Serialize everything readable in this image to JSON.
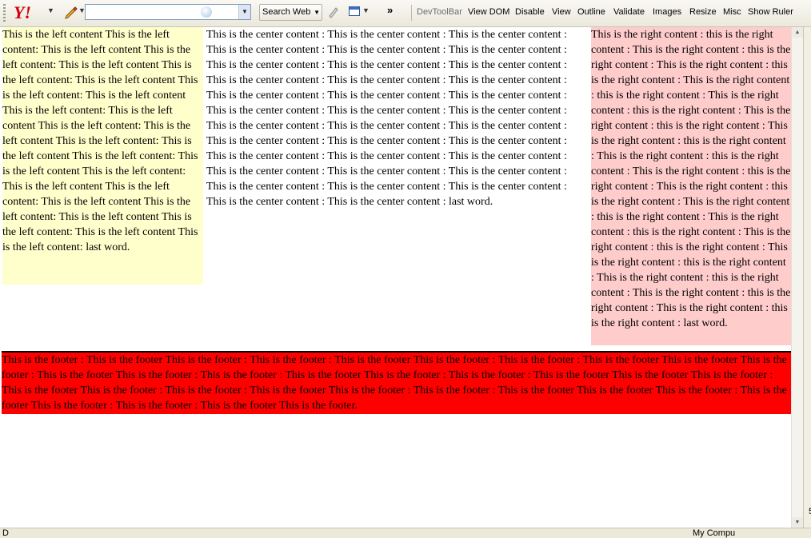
{
  "toolbar": {
    "logo": "Y!",
    "search_value": "",
    "search_button": "Search Web",
    "overflow": "»",
    "devtoolbar_label": "DevToolBar",
    "items": [
      "View DOM",
      "Disable",
      "View",
      "Outline",
      "Validate",
      "Images",
      "Resize",
      "Misc",
      "Show Ruler"
    ]
  },
  "content": {
    "left": "This is the left content This is the left content: This is the left content This is the left content: This is the left content This is the left content: This is the left content This is the left content: This is the left content This is the left content: This is the left content This is the left content: This is the left content This is the left content: This is the left content This is the left content: This is the left content This is the left content: This is the left content This is the left content: This is the left content This is the left content: This is the left content This is the left content: This is the left content This is the left content: last word.",
    "center": "This is the center content : This is the center content : This is the center content : This is the center content : This is the center content : This is the center content : This is the center content : This is the center content : This is the center content : This is the center content : This is the center content : This is the center content : This is the center content : This is the center content : This is the center content : This is the center content : This is the center content : This is the center content : This is the center content : This is the center content : This is the center content : This is the center content : This is the center content : This is the center content : This is the center content : This is the center content : This is the center content : This is the center content : This is the center content : This is the center content : This is the center content : This is the center content : This is the center content : This is the center content : This is the center content : last word.",
    "right": "This is the right content : this is the right content : This is the right content : this is the right content : This is the right content : this is the right content : This is the right content : this is the right content : This is the right content : this is the right content : This is the right content : this is the right content : This is the right content : this is the right content : This is the right content : this is the right content : This is the right content : this is the right content : This is the right content : this is the right content : This is the right content : this is the right content : This is the right content : this is the right content : This is the right content : this is the right content : This is the right content : this is the right content : This is the right content : this is the right content : This is the right content : this is the right content : This is the right content : this is the right content : last word.",
    "footer": "This is the footer : This is the footer This is the footer : This is the footer : This is the footer This is the footer : This is the footer : This is the footer This is the footer This is the footer : This is the footer This is the footer : This is the footer : This is the footer This is the footer : This is the footer : This is the footer This is the footer This is the footer : This is the footer This is the footer : This is the footer : This is the footer This is the footer : This is the footer : This is the footer This is the footer This is the footer : This is the footer This is the footer : This is the footer : This is the footer This is the footer."
  },
  "colors": {
    "left_bg": "#ffffcc",
    "right_bg": "#ffcccc",
    "footer_bg": "#ff0000",
    "logo_red": "#d3000b"
  },
  "status": {
    "left": "D",
    "right": "My Compu",
    "edge_number": "5"
  }
}
